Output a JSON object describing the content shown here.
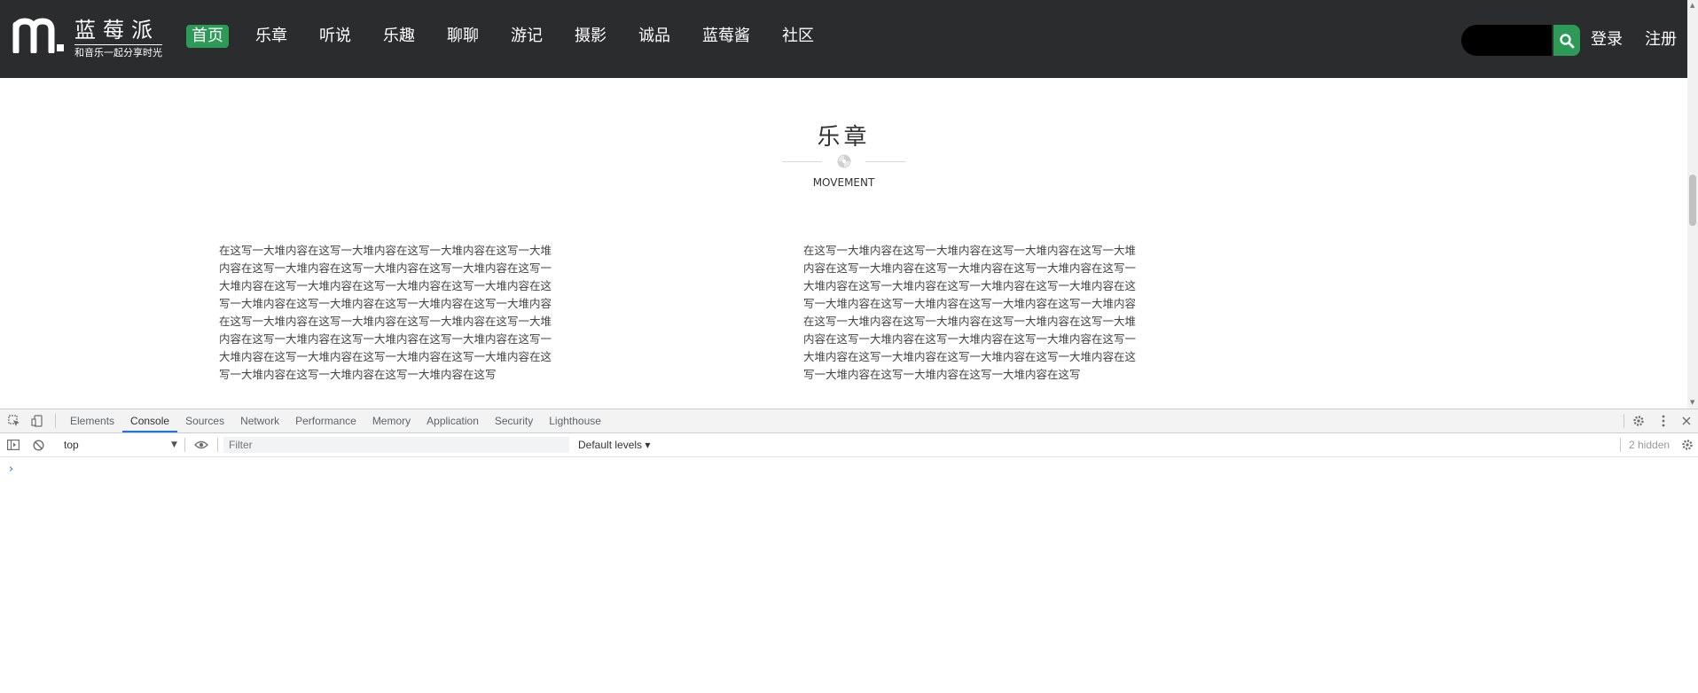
{
  "header": {
    "logo_title": "蓝莓派",
    "logo_slogan": "和音乐一起分享时光",
    "nav": [
      {
        "label": "首页",
        "active": true
      },
      {
        "label": "乐章",
        "active": false
      },
      {
        "label": "听说",
        "active": false
      },
      {
        "label": "乐趣",
        "active": false
      },
      {
        "label": "聊聊",
        "active": false
      },
      {
        "label": "游记",
        "active": false
      },
      {
        "label": "摄影",
        "active": false
      },
      {
        "label": "诚品",
        "active": false
      },
      {
        "label": "蓝莓酱",
        "active": false
      },
      {
        "label": "社区",
        "active": false
      }
    ],
    "login": "登录",
    "register": "注册",
    "search_icon": "search-icon"
  },
  "section": {
    "title": "乐章",
    "subtitle": "MOVEMENT"
  },
  "articles": [
    {
      "text": "在这写一大堆内容在这写一大堆内容在这写一大堆内容在这写一大堆内容在这写一大堆内容在这写一大堆内容在这写一大堆内容在这写一大堆内容在这写一大堆内容在这写一大堆内容在这写一大堆内容在这写一大堆内容在这写一大堆内容在这写一大堆内容在这写一大堆内容 在这写一大堆内容在这写一大堆内容在这写一大堆内容在这写一大堆内容在这写一大堆内容在这写一大堆内容在这写一大堆内容在这写一大堆内容在这写一大堆内容在这写一大堆内容在这写一大堆内容在这写一大堆内容在这写一大堆内容在这写一大堆内容在这写"
    },
    {
      "text": "在这写一大堆内容在这写一大堆内容在这写一大堆内容在这写一大堆内容在这写一大堆内容在这写一大堆内容在这写一大堆内容在这写一大堆内容在这写一大堆内容在这写一大堆内容在这写一大堆内容在这写一大堆内容在这写一大堆内容在这写一大堆内容在这写一大堆内容 在这写一大堆内容在这写一大堆内容在这写一大堆内容在这写一大堆内容在这写一大堆内容在这写一大堆内容在这写一大堆内容在这写一大堆内容在这写一大堆内容在这写一大堆内容在这写一大堆内容在这写一大堆内容在这写一大堆内容在这写一大堆内容在这写"
    }
  ],
  "devtools": {
    "tabs": [
      {
        "label": "Elements",
        "active": false
      },
      {
        "label": "Console",
        "active": true
      },
      {
        "label": "Sources",
        "active": false
      },
      {
        "label": "Network",
        "active": false
      },
      {
        "label": "Performance",
        "active": false
      },
      {
        "label": "Memory",
        "active": false
      },
      {
        "label": "Application",
        "active": false
      },
      {
        "label": "Security",
        "active": false
      },
      {
        "label": "Lighthouse",
        "active": false
      }
    ],
    "context": "top",
    "filter_placeholder": "Filter",
    "levels": "Default levels ▾",
    "hidden_count": "2 hidden",
    "prompt": "›"
  },
  "colors": {
    "nav_bg": "#2a2c2e",
    "accent_green": "#2e9a57",
    "devtools_active": "#1a73e8"
  }
}
